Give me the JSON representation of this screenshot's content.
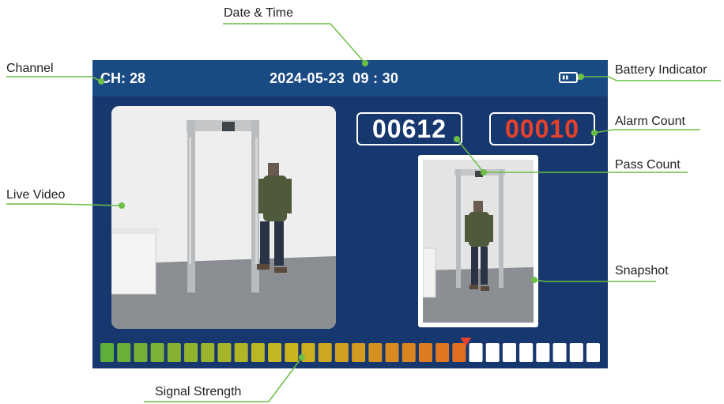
{
  "header": {
    "channel": "CH: 28",
    "date": "2024-05-23",
    "time": "09 : 30"
  },
  "counts": {
    "pass": "00612",
    "alarm": "00010"
  },
  "signal_strength": {
    "total_bars": 30,
    "active_bars": 22,
    "marker_position_bar": 22
  },
  "callouts": {
    "date_time": "Date & Time",
    "channel": "Channel",
    "battery": "Battery Indicator",
    "alarm_count": "Alarm Count",
    "pass_count": "Pass Count",
    "live_video": "Live Video",
    "snapshot": "Snapshot",
    "signal_strength": "Signal Strength"
  },
  "colors": {
    "screen_bg": "#17386f",
    "header_bg": "#1a4a84",
    "alarm_text": "#e8412c",
    "callout_line": "#6cbe45",
    "signal_low": "#5fae3a",
    "signal_mid": "#c9b821",
    "signal_high": "#e07020",
    "marker": "#e8412c"
  },
  "icons": {
    "battery": "battery-icon",
    "marker": "signal-marker-icon"
  }
}
